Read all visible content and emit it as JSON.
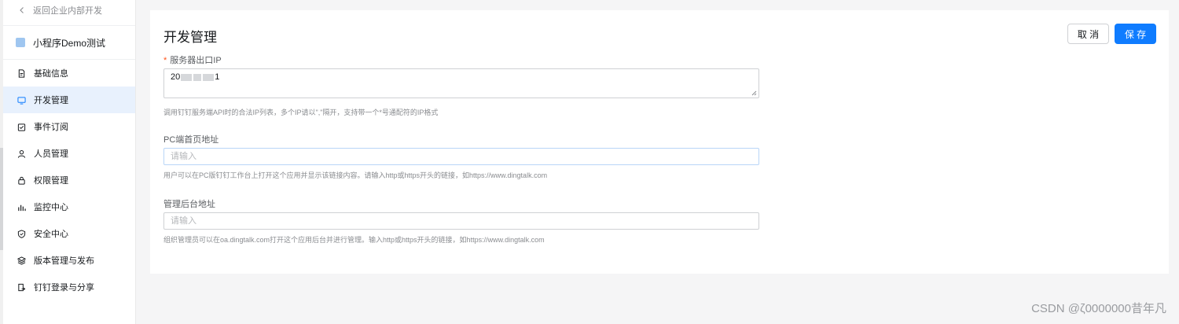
{
  "sidebar": {
    "back_label": "返回企业内部开发",
    "app_name": "小程序Demo测试",
    "items": [
      {
        "label": "基础信息",
        "icon": "document-icon"
      },
      {
        "label": "开发管理",
        "icon": "monitor-icon",
        "active": true
      },
      {
        "label": "事件订阅",
        "icon": "calendar-check-icon"
      },
      {
        "label": "人员管理",
        "icon": "user-icon"
      },
      {
        "label": "权限管理",
        "icon": "lock-icon"
      },
      {
        "label": "监控中心",
        "icon": "bar-chart-icon"
      },
      {
        "label": "安全中心",
        "icon": "shield-icon"
      },
      {
        "label": "版本管理与发布",
        "icon": "layers-icon"
      },
      {
        "label": "钉钉登录与分享",
        "icon": "share-icon"
      }
    ]
  },
  "main": {
    "title": "开发管理",
    "cancel_label": "取 消",
    "save_label": "保 存",
    "fields": {
      "server_ip": {
        "required_mark": "*",
        "label": "服务器出口IP",
        "value_prefix": "20",
        "value_suffix": "1",
        "hint": "调用钉钉服务端API时的合法IP列表，多个IP请以\",\"隔开，支持带一个*号通配符的IP格式"
      },
      "pc_home": {
        "label": "PC端首页地址",
        "placeholder": "请输入",
        "hint": "用户可以在PC版钉钉工作台上打开这个应用并显示该链接内容。请输入http或https开头的链接，如https://www.dingtalk.com"
      },
      "admin_url": {
        "label": "管理后台地址",
        "placeholder": "请输入",
        "hint": "组织管理员可以在oa.dingtalk.com打开这个应用后台并进行管理。输入http或https开头的链接，如https://www.dingtalk.com"
      }
    }
  },
  "watermark": "CSDN @ζ0000000昔年凡",
  "colors": {
    "primary": "#0f7cff",
    "active_bg": "#e8f1fd",
    "required": "#ff5219"
  }
}
